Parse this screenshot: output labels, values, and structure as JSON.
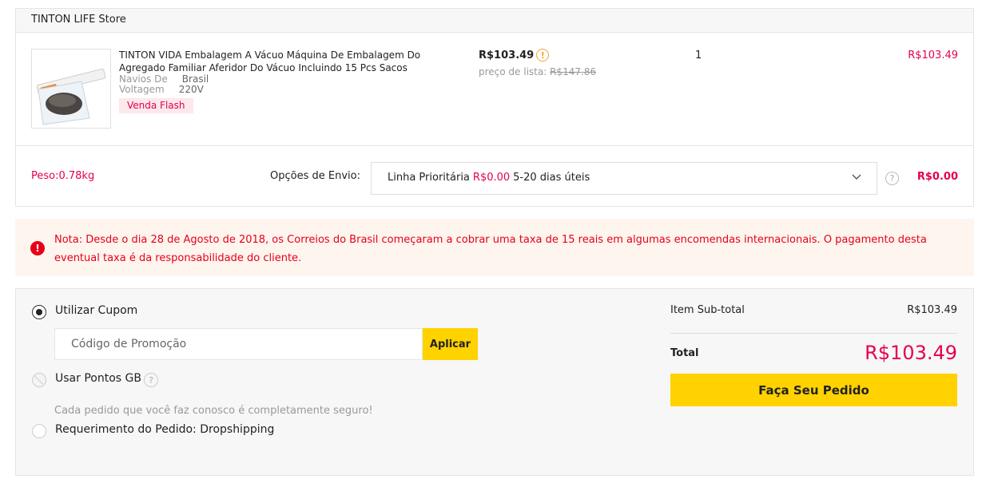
{
  "store": {
    "name": "TINTON LIFE Store"
  },
  "product": {
    "title": "TINTON VIDA Embalagem A Vácuo Máquina De Embalagem Do Agregado Familiar Aferidor Do Vácuo Incluindo 15 Pcs Sacos",
    "attributes": [
      {
        "name": "Navios De",
        "value": "Brasil"
      },
      {
        "name": "Voltagem",
        "value": "220V"
      }
    ],
    "badge": "Venda Flash",
    "unit_price": "R$103.49",
    "list_price_label": "preço de lista:",
    "list_price": "R$147.86",
    "quantity": "1",
    "line_total": "R$103.49"
  },
  "shipping": {
    "weight": "Peso:0.78kg",
    "label": "Opções de Envio:",
    "method": "Linha Prioritária",
    "method_price": "R$0.00",
    "method_eta": "5-20 dias úteis",
    "cost": "R$0.00",
    "help_glyph": "?"
  },
  "notice": {
    "icon_glyph": "!",
    "text": "Nota: Desde o dia 28 de Agosto de 2018, os Correios do Brasil começaram a cobrar uma taxa de 15 reais em algumas encomendas internacionais. O pagamento desta eventual taxa é da responsabilidade do cliente."
  },
  "checkout": {
    "coupon_label": "Utilizar Cupom",
    "promo_placeholder": "Código de Promoção",
    "apply_label": "Aplicar",
    "points_label": "Usar Pontos GB",
    "points_help_glyph": "?",
    "secure_text": "Cada pedido que você faz conosco é completamente seguro!",
    "dropship_label": "Requerimento do Pedido: Dropshipping"
  },
  "summary": {
    "subtotal_label": "Item Sub-total",
    "subtotal_value": "R$103.49",
    "total_label": "Total",
    "total_value": "R$103.49",
    "place_order_label": "Faça Seu Pedido"
  },
  "colors": {
    "accent_red": "#e5004f",
    "notice_red": "#e5001a",
    "button_yellow": "#ffd200",
    "warn_orange": "#f5a623"
  },
  "icons": {
    "price_warning": "exclamation-circle-icon",
    "notice": "alert-circle-icon",
    "chevron": "chevron-down-icon",
    "help": "question-circle-icon"
  }
}
